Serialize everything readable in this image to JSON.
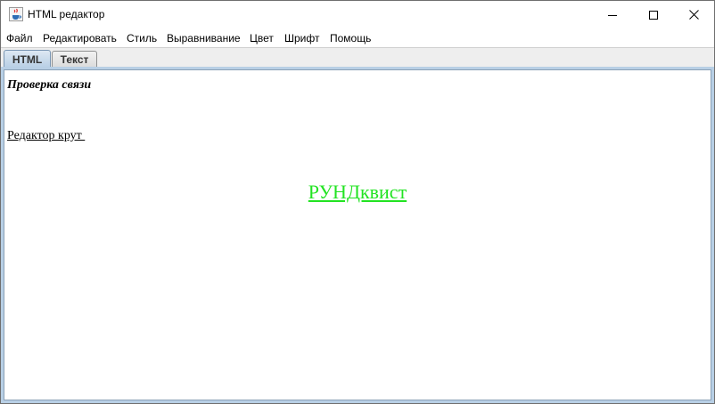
{
  "window": {
    "title": "HTML редактор",
    "icons": {
      "app": "java-cup-icon",
      "minimize": "minimize-icon",
      "maximize": "maximize-icon",
      "close": "close-icon"
    }
  },
  "menu": {
    "items": [
      "Файл",
      "Редактировать",
      "Стиль",
      "Выравнивание",
      "Цвет",
      "Шрифт",
      "Помощь"
    ]
  },
  "tabs": {
    "items": [
      "HTML",
      "Текст"
    ],
    "selected": "HTML"
  },
  "editor": {
    "line1": "Проверка связи",
    "line2": "Редактор крут ",
    "line3": "РУНДквист",
    "line3_color": "#22e322"
  }
}
